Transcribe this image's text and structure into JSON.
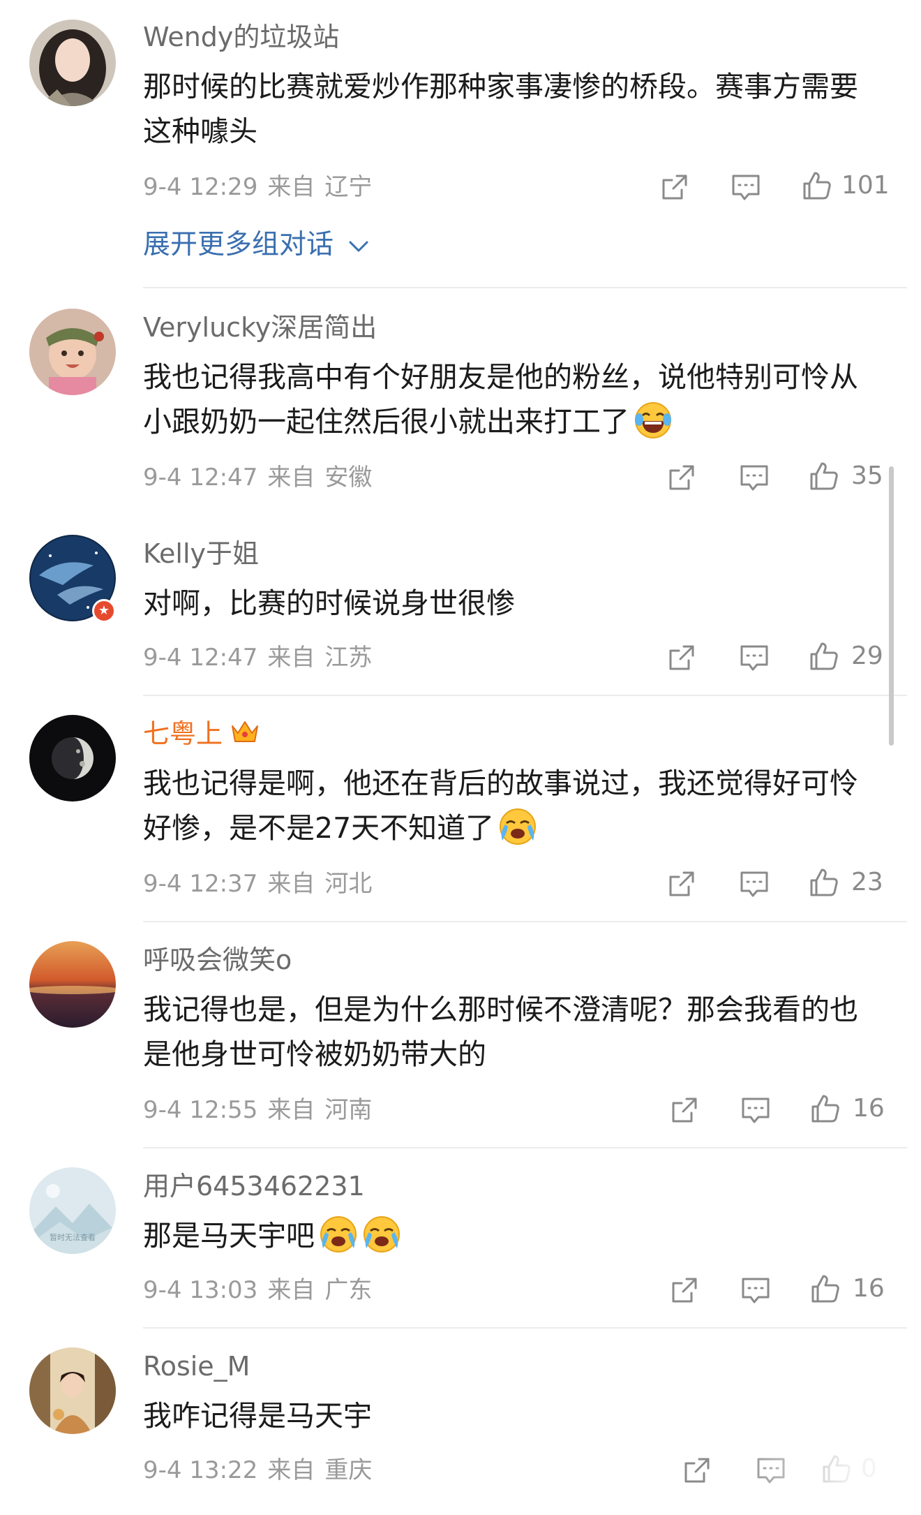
{
  "expand_more": "展开更多组对话",
  "comments": [
    {
      "username": "Wendy的垃圾站",
      "text": "那时候的比赛就爱炒作那种家事凄惨的桥段。赛事方需要这种噱头",
      "date": "9-4 12:29",
      "location_label": "来自",
      "location": "辽宁",
      "likes": "101"
    },
    {
      "username": "Verylucky深居简出",
      "text": "我也记得我高中有个好朋友是他的粉丝，说他特别可怜从小跟奶奶一起住然后很小就出来打工了",
      "date": "9-4 12:47",
      "location_label": "来自",
      "location": "安徽",
      "likes": "35"
    },
    {
      "username": "Kelly于姐",
      "text": "对啊，比赛的时候说身世很惨",
      "date": "9-4 12:47",
      "location_label": "来自",
      "location": "江苏",
      "likes": "29"
    },
    {
      "username": "七粤上",
      "text": "我也记得是啊，他还在背后的故事说过，我还觉得好可怜好惨，是不是27天不知道了",
      "date": "9-4 12:37",
      "location_label": "来自",
      "location": "河北",
      "likes": "23"
    },
    {
      "username": "呼吸会微笑o",
      "text": "我记得也是，但是为什么那时候不澄清呢？那会我看的也是他身世可怜被奶奶带大的",
      "date": "9-4 12:55",
      "location_label": "来自",
      "location": "河南",
      "likes": "16"
    },
    {
      "username": "用户6453462231",
      "text": "那是马天宇吧",
      "date": "9-4 13:03",
      "location_label": "来自",
      "location": "广东",
      "likes": "16",
      "avatar_caption": "暂时无法查看"
    },
    {
      "username": "Rosie_M",
      "text": "我咋记得是马天宇",
      "date": "9-4 13:22",
      "location_label": "来自",
      "location": "重庆",
      "likes": "0"
    }
  ],
  "colors": {
    "username": "#6b6b6b",
    "vip_username": "#f0701f",
    "body": "#1b1b1b",
    "meta": "#9a9a9a",
    "link": "#3a6fb0",
    "divider": "#ececec"
  },
  "icons": [
    "share-icon",
    "comment-icon",
    "like-icon",
    "chevron-down-icon",
    "crown-icon",
    "laughing-tears-emoji",
    "crying-emoji"
  ]
}
